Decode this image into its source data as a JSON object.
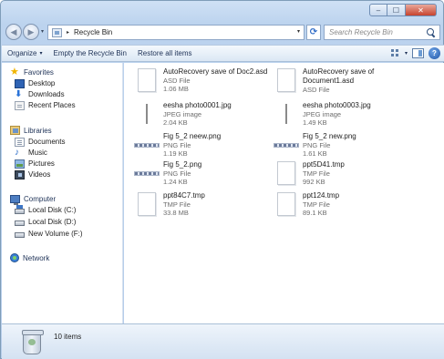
{
  "window": {
    "caption": {
      "minimize": "–",
      "maximize": "☐",
      "close": "✕"
    }
  },
  "navbar": {
    "back": "◀",
    "forward": "▶",
    "history_caret": "▾",
    "breadcrumb_separator": "▸",
    "address": "Recycle Bin",
    "address_caret": "▾",
    "refresh": "⟳",
    "search_placeholder": "Search Recycle Bin"
  },
  "toolbar": {
    "organize": "Organize",
    "organize_caret": "▾",
    "empty": "Empty the Recycle Bin",
    "restore": "Restore all items",
    "views_caret": "▾",
    "help": "?"
  },
  "sidebar": {
    "favorites": {
      "label": "Favorites",
      "star": "★",
      "items": [
        {
          "label": "Desktop",
          "icon": "desktop-icon"
        },
        {
          "label": "Downloads",
          "icon": "downloads-icon",
          "glyph": "⬇"
        },
        {
          "label": "Recent Places",
          "icon": "recent-places-icon"
        }
      ]
    },
    "libraries": {
      "label": "Libraries",
      "items": [
        {
          "label": "Documents",
          "icon": "documents-icon"
        },
        {
          "label": "Music",
          "icon": "music-icon",
          "glyph": "♪"
        },
        {
          "label": "Pictures",
          "icon": "pictures-icon"
        },
        {
          "label": "Videos",
          "icon": "videos-icon"
        }
      ]
    },
    "computer": {
      "label": "Computer",
      "items": [
        {
          "label": "Local Disk (C:)",
          "icon": "drive-c-icon"
        },
        {
          "label": "Local Disk (D:)",
          "icon": "drive-icon"
        },
        {
          "label": "New Volume (F:)",
          "icon": "drive-icon"
        }
      ]
    },
    "network": {
      "label": "Network"
    }
  },
  "files": [
    {
      "name": "AutoRecovery save of Doc2.asd",
      "name2": "",
      "type": "ASD File",
      "size": "1.06 MB",
      "thumb": "doc"
    },
    {
      "name": "AutoRecovery save of",
      "name2": "Document1.asd",
      "type": "ASD File",
      "size": "",
      "thumb": "doc"
    },
    {
      "name": "eesha photo0001.jpg",
      "name2": "",
      "type": "JPEG image",
      "size": "2.04 KB",
      "thumb": "jpg"
    },
    {
      "name": "eesha photo0003.jpg",
      "name2": "",
      "type": "JPEG image",
      "size": "1.49 KB",
      "thumb": "jpg"
    },
    {
      "name": "Fig 5_2 neew.png",
      "name2": "",
      "type": "PNG File",
      "size": "1.19 KB",
      "thumb": "png"
    },
    {
      "name": "Fig 5_2 new.png",
      "name2": "",
      "type": "PNG File",
      "size": "1.61 KB",
      "thumb": "png"
    },
    {
      "name": "Fig 5_2.png",
      "name2": "",
      "type": "PNG File",
      "size": "1.24 KB",
      "thumb": "png"
    },
    {
      "name": "ppt5D41.tmp",
      "name2": "",
      "type": "TMP File",
      "size": "992 KB",
      "thumb": "doc"
    },
    {
      "name": "ppt84C7.tmp",
      "name2": "",
      "type": "TMP File",
      "size": "33.8 MB",
      "thumb": "doc"
    },
    {
      "name": "ppt124.tmp",
      "name2": "",
      "type": "TMP File",
      "size": "89.1 KB",
      "thumb": "doc"
    }
  ],
  "status": {
    "count": "10 items"
  }
}
